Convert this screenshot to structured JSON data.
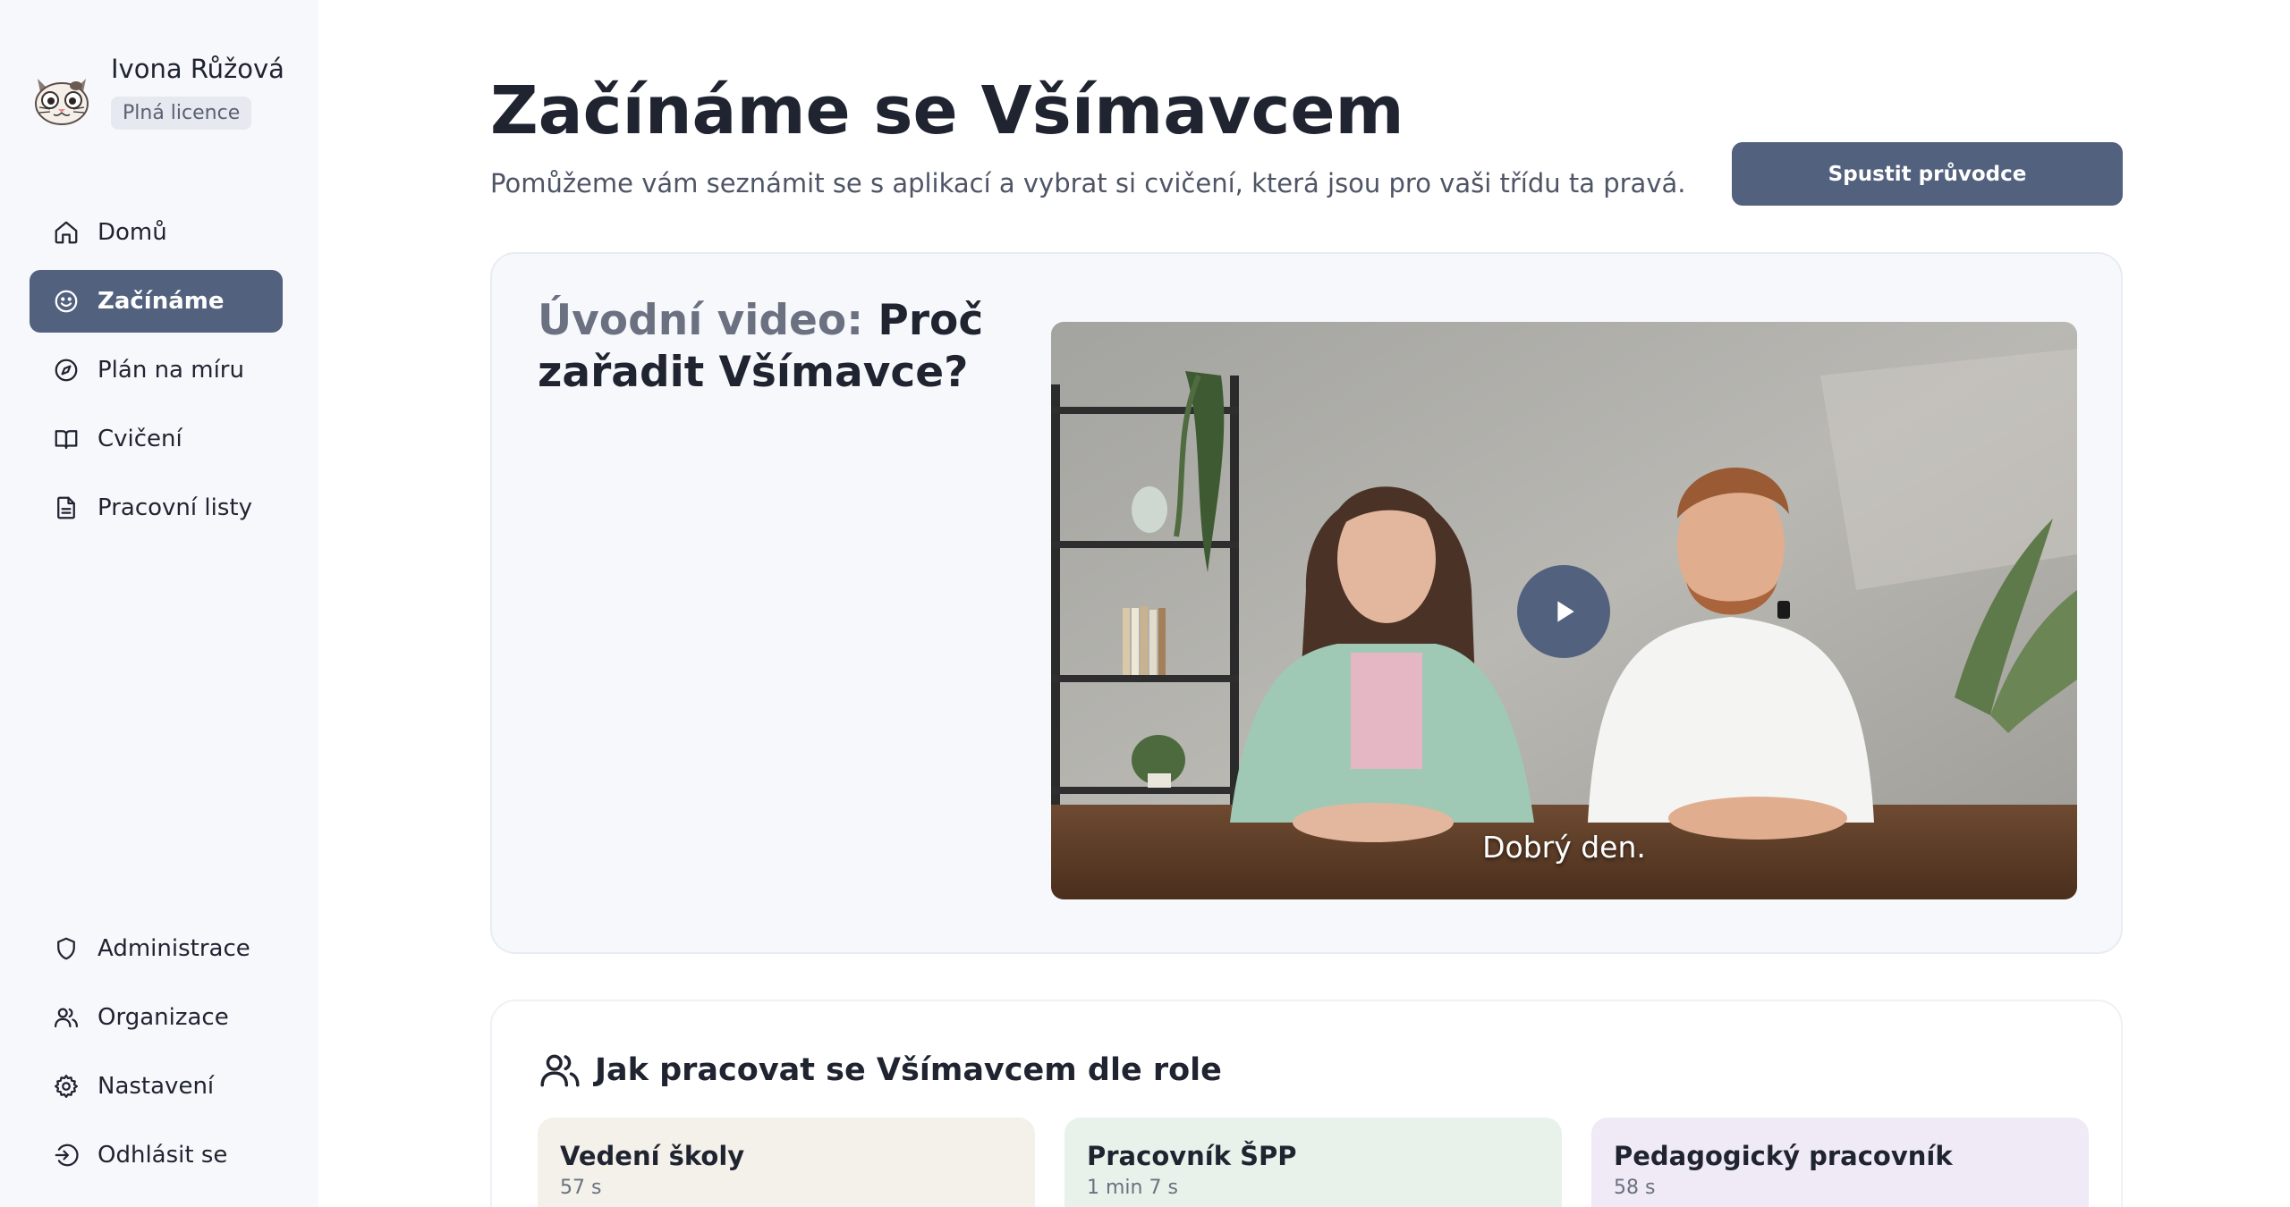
{
  "user": {
    "name": "Ivona Růžová",
    "license": "Plná licence",
    "avatar_icon": "cat-avatar-icon"
  },
  "sidebar": {
    "top_items": [
      {
        "label": "Domů",
        "icon": "home-icon",
        "active": false
      },
      {
        "label": "Začínáme",
        "icon": "smile-icon",
        "active": true
      },
      {
        "label": "Plán na míru",
        "icon": "compass-icon",
        "active": false
      },
      {
        "label": "Cvičení",
        "icon": "book-icon",
        "active": false
      },
      {
        "label": "Pracovní listy",
        "icon": "document-icon",
        "active": false
      }
    ],
    "bottom_items": [
      {
        "label": "Administrace",
        "icon": "shield-icon"
      },
      {
        "label": "Organizace",
        "icon": "users-icon"
      },
      {
        "label": "Nastavení",
        "icon": "gear-icon"
      },
      {
        "label": "Odhlásit se",
        "icon": "logout-icon"
      }
    ]
  },
  "main": {
    "title": "Začínáme se Všímavcem",
    "subtitle": "Pomůžeme vám seznámit se s aplikací a vybrat si cvičení, která jsou pro vaši třídu ta pravá.",
    "guide_button": "Spustit průvodce",
    "video": {
      "heading_prefix": "Úvodní video:",
      "heading_rest": "Proč zařadit Všímavce?",
      "caption": "Dobrý den."
    },
    "roles": {
      "heading": "Jak pracovat se Všímavcem dle role",
      "items": [
        {
          "title": "Vedení školy",
          "duration": "57 s",
          "color": "#f3f1ea"
        },
        {
          "title": "Pracovník ŠPP",
          "duration": "1 min 7 s",
          "color": "#e9f2ea"
        },
        {
          "title": "Pedagogický pracovník",
          "duration": "58 s",
          "color": "#efeaf6"
        }
      ]
    }
  },
  "colors": {
    "accent": "#52617e",
    "sidebar_bg": "#f6f8fc"
  }
}
